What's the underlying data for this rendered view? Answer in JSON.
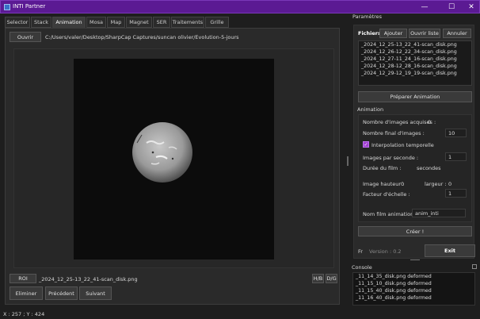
{
  "window": {
    "title": "INTI Partner",
    "minimize": "—",
    "maximize": "☐",
    "close": "✕"
  },
  "tabs": [
    "Selector",
    "Stack",
    "Animation",
    "Mosa",
    "Map",
    "Magnet",
    "SER",
    "Traitements",
    "Grille"
  ],
  "active_tab": "Animation",
  "open_button": "Ouvrir",
  "path": "C:/Users/valer/Desktop/SharpCap Captures/suncan olivier/Evolution-5-jours",
  "roi_button": "ROI",
  "current_file": "_2024_12_25-13_22_41-scan_disk.png",
  "hb_button": "H/B",
  "dg_button": "D/G",
  "nav": {
    "delete": "Eliminer",
    "previous": "Précédent",
    "next": "Suivant"
  },
  "status": "X : 257 ; Y : 424",
  "params": {
    "title": "Paramètres",
    "files_label": "Fichiers",
    "add_button": "Ajouter",
    "open_list_button": "Ouvrir liste",
    "cancel_button": "Annuler",
    "files": [
      "_2024_12_25-13_22_41-scan_disk.png",
      "_2024_12_26-12_22_34-scan_disk.png",
      "_2024_12_27-11_24_16-scan_disk.png",
      "_2024_12_28-12_28_16-scan_disk.png",
      "_2024_12_29-12_19_19-scan_disk.png"
    ],
    "prepare_button": "Préparer Animation"
  },
  "animation": {
    "title": "Animation",
    "acquired_label": "Nombre d'images acquises :",
    "acquired_value": "0",
    "final_label": "Nombre final d'images :",
    "final_value": "10",
    "interp_label": "Interpolation temporelle",
    "interp_checked": true,
    "fps_label": "Images par seconde :",
    "fps_value": "1",
    "duration_label": "Durée du film :",
    "duration_unit": "secondes",
    "height_label": "Image hauteur :",
    "height_value": "0",
    "width_label": "largeur :",
    "width_value": "0",
    "scale_label": "Facteur d'échelle :",
    "scale_value": "1",
    "filename_label": "Nom film animation :",
    "filename_value": "anim_inti",
    "create_button": "Créer !"
  },
  "footer": {
    "lang": "Fr",
    "version": "Version : 0.2",
    "quit_button": "Exit"
  },
  "console": {
    "title": "Console",
    "lines": [
      "_11_14_35_disk.png deformed",
      "_11_15_10_disk.png deformed",
      "_11_15_40_disk.png deformed",
      "_11_16_40_disk.png deformed"
    ]
  },
  "colors": {
    "titlebar": "#5b1a93",
    "accent_check": "#a040d0",
    "background": "#1e1e1e"
  }
}
